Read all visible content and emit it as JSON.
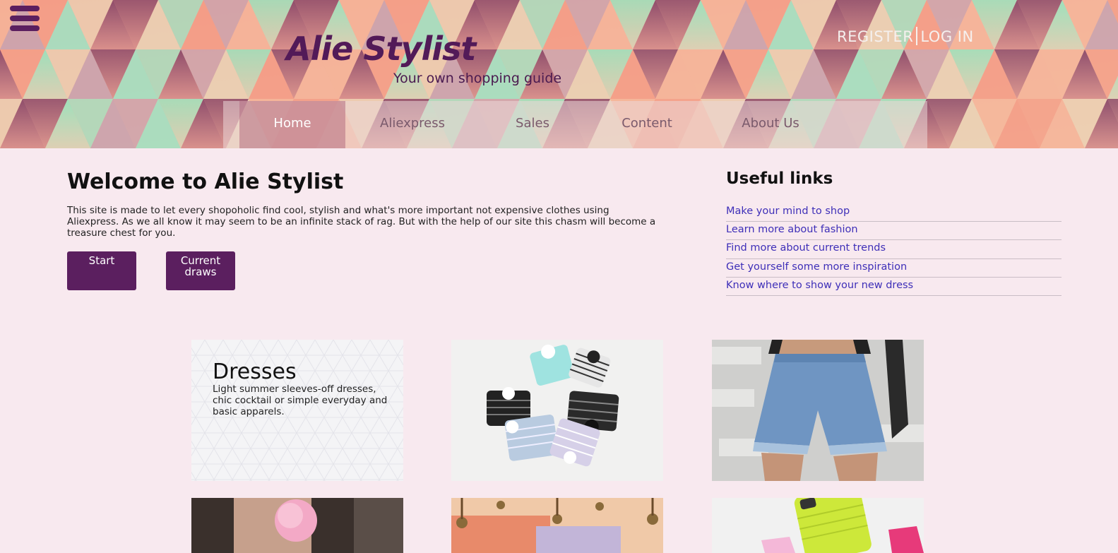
{
  "header": {
    "logo": "Alie Stylist",
    "tagline": "Your own shopping guide",
    "register": "REGISTER",
    "login": "LOG IN"
  },
  "nav": [
    {
      "label": "Home",
      "active": true
    },
    {
      "label": "Aliexpress",
      "active": false
    },
    {
      "label": "Sales",
      "active": false
    },
    {
      "label": "Content",
      "active": false
    },
    {
      "label": "About Us",
      "active": false
    }
  ],
  "main": {
    "title": "Welcome to Alie Stylist",
    "intro": "This site is made to let every shopoholic find cool, stylish and what's more important not expensive clothes using Aliexpress. As we all know it may seem to be an infinite stack of rag. But with the help of our site this chasm will become a treasure chest for you.",
    "buttons": {
      "start": "Start",
      "draws_line1": "Current",
      "draws_line2": "draws"
    }
  },
  "sidebar": {
    "title": "Useful links",
    "links": [
      "Make your mind to shop",
      "Learn more about fashion",
      "Find more about current trends",
      "Get yourself some more inspiration",
      "Know where to show your new dress"
    ]
  },
  "tiles": {
    "dresses_title": "Dresses",
    "dresses_desc": "Light summer sleeves-off dresses, chic cocktail or simple everyday and basic apparels."
  },
  "colors": {
    "accent": "#5b1f5f",
    "link": "#3e2fb8",
    "background": "#f8e9ef"
  }
}
